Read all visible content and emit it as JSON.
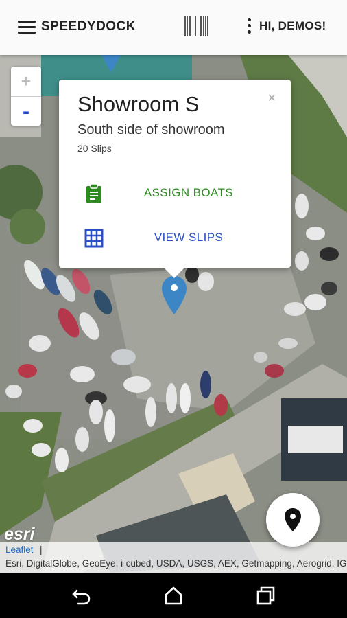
{
  "app": {
    "brand": "SPEEDYDOCK",
    "user_label": "HI, DEMOS!"
  },
  "map": {
    "zoom_in_label": "+",
    "zoom_out_label": "-",
    "esri_logo": "esri",
    "attribution_link": "Leaflet",
    "attribution_sep": "|",
    "attribution_credits": "Esri, DigitalGlobe, GeoEye, i-cubed, USDA, USGS, AEX, Getmapping, Aerogrid, IGN, IGP, swisstopo"
  },
  "popup": {
    "title": "Showroom S",
    "subtitle": "South side of showroom",
    "slip_count": "20 Slips",
    "close_label": "×",
    "actions": [
      {
        "label": "ASSIGN BOATS",
        "icon": "clipboard-icon",
        "color": "#2c8a1f"
      },
      {
        "label": "VIEW SLIPS",
        "icon": "grid-icon",
        "color": "#2b4fc7"
      }
    ]
  },
  "colors": {
    "marker": "#3d86c6",
    "zoom_out": "#1a49c9"
  }
}
